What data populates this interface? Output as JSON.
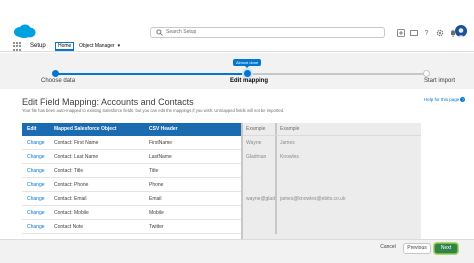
{
  "header": {
    "search_placeholder": "Search Setup",
    "icons": [
      "add-icon",
      "favorites-icon",
      "help-icon",
      "gear-icon",
      "notifications-icon"
    ],
    "help_glyph": "?"
  },
  "nav": {
    "app_title": "Setup",
    "tabs": [
      {
        "label": "Home"
      },
      {
        "label": "Object Manager"
      }
    ]
  },
  "wizard": {
    "steps": [
      {
        "label": "Choose data",
        "state": "done"
      },
      {
        "label": "Edit mapping",
        "state": "current"
      },
      {
        "label": "Start import",
        "state": "todo"
      }
    ],
    "badge": "Almost done",
    "progress_fraction": 0.52
  },
  "page": {
    "title": "Edit Field Mapping: Accounts and Contacts",
    "subtitle": "Your file has been auto-mapped to existing Salesforce fields, but you can edit the mappings if you wish. Unmapped fields will not be imported.",
    "help_link": "Help for this page"
  },
  "mapping_table": {
    "columns": [
      "Edit",
      "Mapped Salesforce Object",
      "CSV Header"
    ],
    "rows": [
      {
        "edit": "Change",
        "object": "Contact: First Name",
        "csv": "FirstName"
      },
      {
        "edit": "Change",
        "object": "Contact: Last Name",
        "csv": "LastName"
      },
      {
        "edit": "Change",
        "object": "Contact: Title",
        "csv": "Title"
      },
      {
        "edit": "Change",
        "object": "Contact: Phone",
        "csv": "Phone"
      },
      {
        "edit": "Change",
        "object": "Contact: Email",
        "csv": "Email"
      },
      {
        "edit": "Change",
        "object": "Contact: Mobile",
        "csv": "Mobile"
      },
      {
        "edit": "Change",
        "object": "Contact Note",
        "csv": "Twitter"
      }
    ]
  },
  "examples": {
    "columns": [
      "Example",
      "Example"
    ],
    "rows": [
      [
        "Wayne",
        "James"
      ],
      [
        "Gladman",
        "Knowles"
      ],
      [
        "",
        ""
      ],
      [
        "",
        ""
      ],
      [
        "wayne@gladman",
        "james@knowles@ebits.co.uk"
      ],
      [
        "",
        ""
      ],
      [
        "",
        ""
      ]
    ]
  },
  "footer": {
    "cancel": "Cancel",
    "previous": "Previous",
    "next": "Next"
  },
  "colors": {
    "brand": "#0176d3",
    "table_header": "#1b6bb0",
    "next_button": "#2e844a"
  }
}
